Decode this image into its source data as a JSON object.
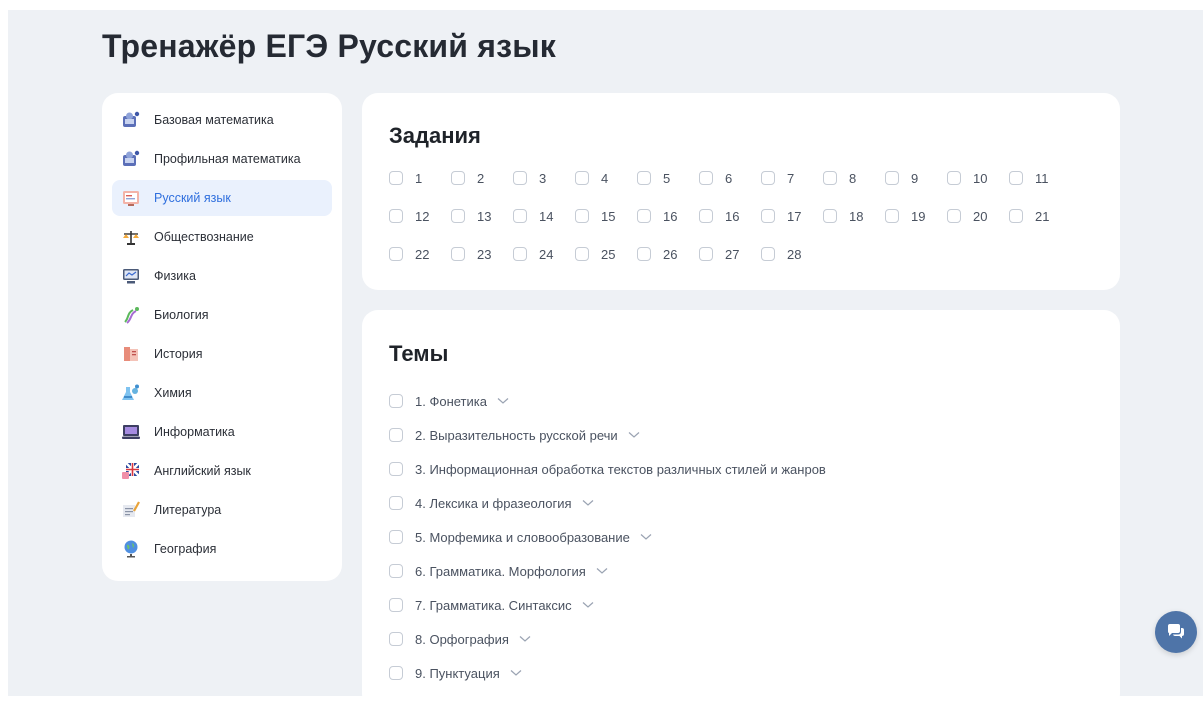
{
  "page": {
    "title": "Тренажёр ЕГЭ Русский язык"
  },
  "sidebar": {
    "items": [
      {
        "label": "Базовая математика",
        "icon": "basic-math-icon",
        "active": false
      },
      {
        "label": "Профильная математика",
        "icon": "profile-math-icon",
        "active": false
      },
      {
        "label": "Русский язык",
        "icon": "russian-language-icon",
        "active": true
      },
      {
        "label": "Обществознание",
        "icon": "social-studies-icon",
        "active": false
      },
      {
        "label": "Физика",
        "icon": "physics-icon",
        "active": false
      },
      {
        "label": "Биология",
        "icon": "biology-icon",
        "active": false
      },
      {
        "label": "История",
        "icon": "history-icon",
        "active": false
      },
      {
        "label": "Химия",
        "icon": "chemistry-icon",
        "active": false
      },
      {
        "label": "Информатика",
        "icon": "informatics-icon",
        "active": false
      },
      {
        "label": "Английский язык",
        "icon": "english-icon",
        "active": false
      },
      {
        "label": "Литература",
        "icon": "literature-icon",
        "active": false
      },
      {
        "label": "География",
        "icon": "geography-icon",
        "active": false
      }
    ]
  },
  "tasks": {
    "title": "Задания",
    "rows": [
      [
        "1",
        "2",
        "3",
        "4",
        "5",
        "6",
        "7",
        "8",
        "9",
        "10",
        "11"
      ],
      [
        "12",
        "13",
        "14",
        "15",
        "16",
        "16",
        "17",
        "18",
        "19",
        "20",
        "21"
      ],
      [
        "22",
        "23",
        "24",
        "25",
        "26",
        "27",
        "28"
      ]
    ]
  },
  "topics": {
    "title": "Темы",
    "items": [
      {
        "label": "1. Фонетика",
        "expandable": true
      },
      {
        "label": "2. Выразительность русской речи",
        "expandable": true
      },
      {
        "label": "3. Информационная обработка текстов различных стилей и жанров",
        "expandable": false
      },
      {
        "label": "4. Лексика и фразеология",
        "expandable": true
      },
      {
        "label": "5. Морфемика и словообразование",
        "expandable": true
      },
      {
        "label": "6. Грамматика. Морфология",
        "expandable": true
      },
      {
        "label": "7. Грамматика. Синтаксис",
        "expandable": true
      },
      {
        "label": "8. Орфография",
        "expandable": true
      },
      {
        "label": "9. Пунктуация",
        "expandable": true
      }
    ]
  },
  "colors": {
    "accent": "#2f6fde",
    "active_bg": "#eaf1fd",
    "page_bg": "#eef1f5",
    "chat_button": "#4e74a8"
  },
  "chat": {
    "icon": "chat-bubbles-icon"
  }
}
